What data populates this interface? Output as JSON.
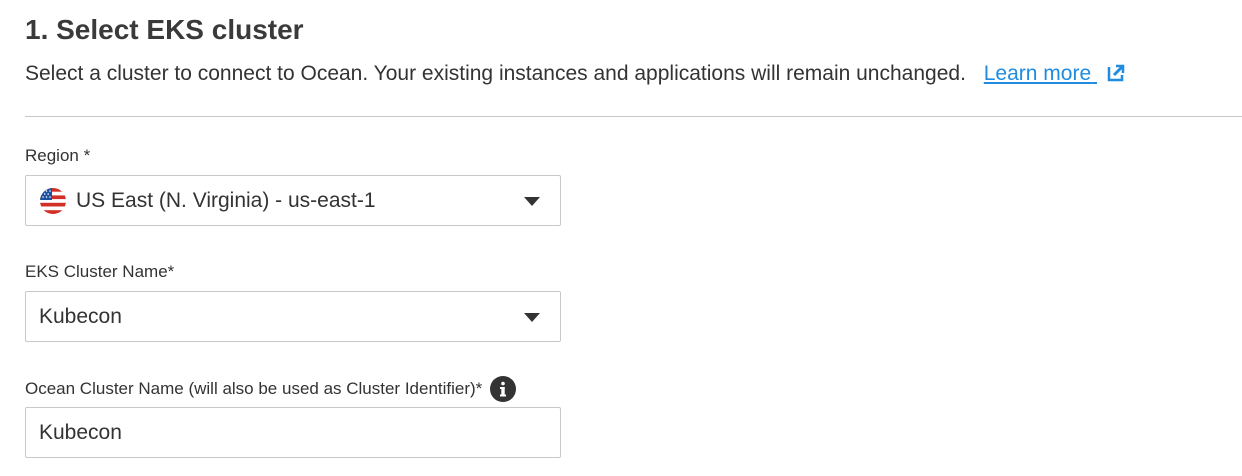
{
  "header": {
    "title": "1. Select EKS cluster",
    "subtitle": "Select a cluster to connect to Ocean. Your existing instances and applications will remain unchanged.",
    "learn_more": "Learn more",
    "link_color": "#1f8ce0"
  },
  "form": {
    "region": {
      "label": "Region *",
      "value": "US East (N. Virginia) - us-east-1",
      "flag_icon": "us-flag-icon"
    },
    "eks_cluster": {
      "label": "EKS Cluster Name*",
      "value": "Kubecon"
    },
    "ocean_cluster": {
      "label": "Ocean Cluster Name (will also be used as Cluster Identifier)*",
      "value": "Kubecon",
      "info_icon": "info-icon"
    }
  }
}
